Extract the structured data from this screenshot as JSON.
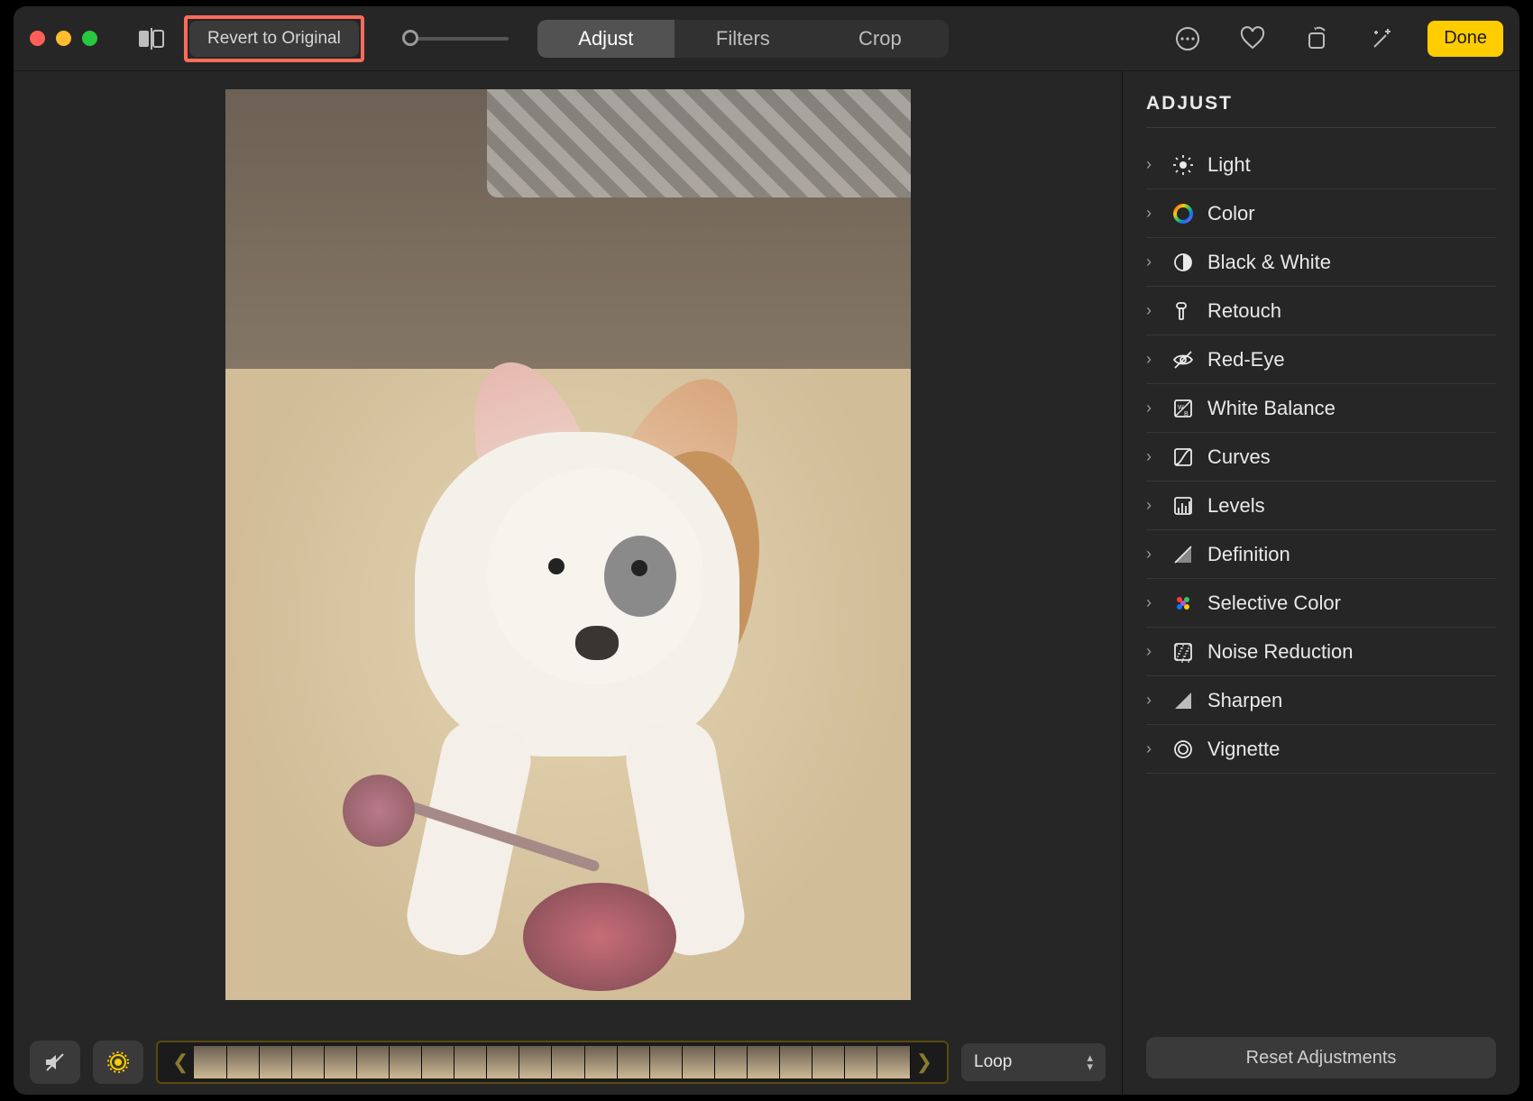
{
  "toolbar": {
    "revert_label": "Revert to Original",
    "tabs": [
      "Adjust",
      "Filters",
      "Crop"
    ],
    "active_tab_index": 0,
    "done_label": "Done"
  },
  "sidebar": {
    "title": "ADJUST",
    "items": [
      {
        "icon": "light-icon",
        "label": "Light"
      },
      {
        "icon": "color-icon",
        "label": "Color"
      },
      {
        "icon": "bw-icon",
        "label": "Black & White"
      },
      {
        "icon": "retouch-icon",
        "label": "Retouch"
      },
      {
        "icon": "redeye-icon",
        "label": "Red-Eye"
      },
      {
        "icon": "whitebalance-icon",
        "label": "White Balance"
      },
      {
        "icon": "curves-icon",
        "label": "Curves"
      },
      {
        "icon": "levels-icon",
        "label": "Levels"
      },
      {
        "icon": "definition-icon",
        "label": "Definition"
      },
      {
        "icon": "selectivecolor-icon",
        "label": "Selective Color"
      },
      {
        "icon": "noise-icon",
        "label": "Noise Reduction"
      },
      {
        "icon": "sharpen-icon",
        "label": "Sharpen"
      },
      {
        "icon": "vignette-icon",
        "label": "Vignette"
      }
    ],
    "reset_label": "Reset Adjustments"
  },
  "bottom": {
    "playback_mode": "Loop"
  }
}
